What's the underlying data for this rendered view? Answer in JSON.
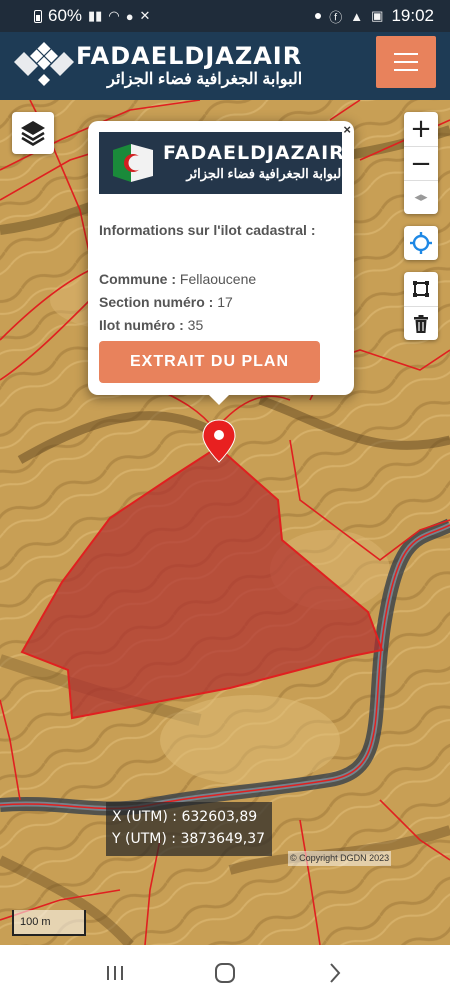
{
  "status_bar": {
    "battery": "60%",
    "time": "19:02"
  },
  "header": {
    "brand_en": "FADAELDJAZAIR",
    "brand_ar": "البوابة الجغرافية فضاء الجزائر"
  },
  "popup": {
    "close": "×",
    "banner_en": "FADAELDJAZAIR",
    "banner_ar": "البوابة الجغرافية فضاء الجزائر",
    "title": "Informations sur l'ilot cadastral :",
    "commune_label": "Commune :",
    "commune_value": "Fellaoucene",
    "section_label": "Section numéro :",
    "section_value": "17",
    "ilot_label": "Ilot numéro :",
    "ilot_value": "35",
    "button": "EXTRAIT DU PLAN"
  },
  "map": {
    "x_label": "X (UTM) :",
    "x_value": "632603,89",
    "y_label": "Y (UTM) :",
    "y_value": "3873649,37",
    "copyright": "© Copyright DGDN 2023",
    "scale": "100 m"
  },
  "colors": {
    "accent": "#e8825c",
    "header": "#1e3b55",
    "parcel": "#b03030",
    "boundary": "#e02020"
  }
}
